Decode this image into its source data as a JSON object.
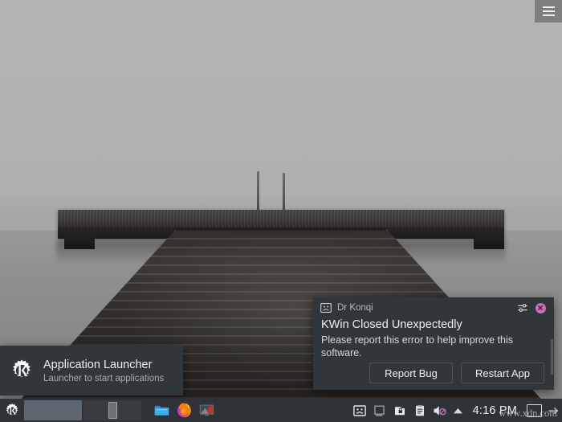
{
  "desktop": {
    "wallpaper_name": "pier-on-foggy-lake",
    "window_button": {
      "icon": "hamburger-menu-icon",
      "label": ""
    }
  },
  "tooltip": {
    "icon": "kde-k-icon",
    "title": "Application Launcher",
    "subtitle": "Launcher to start applications"
  },
  "notification": {
    "app_icon": "sad-face-icon",
    "app_name": "Dr Konqi",
    "configure_icon": "sliders-icon",
    "close_icon": "close-icon",
    "title": "KWin Closed Unexpectedly",
    "message": "Please report this error to help improve this software.",
    "actions": [
      {
        "label": "Report Bug",
        "name": "report-bug-button"
      },
      {
        "label": "Restart App",
        "name": "restart-app-button"
      }
    ],
    "colors": {
      "background": "#31363b",
      "close_button": "#c96fb4",
      "text": "#eff0f1"
    }
  },
  "panel": {
    "launcher": {
      "icon": "kde-k-icon",
      "label": "Application Launcher"
    },
    "tasks": [
      {
        "name": "task-active",
        "state": "active",
        "label": ""
      },
      {
        "name": "task-window",
        "state": "normal",
        "label": ""
      }
    ],
    "launchers": [
      {
        "name": "dolphin-file-manager",
        "icon": "folder-icon",
        "label": "Dolphin"
      },
      {
        "name": "firefox-browser",
        "icon": "firefox-icon",
        "label": "Firefox"
      },
      {
        "name": "display-settings",
        "icon": "monitor-icon",
        "label": "Display"
      }
    ],
    "tray": [
      {
        "name": "dr-konqi-tray",
        "icon": "sad-face-icon"
      },
      {
        "name": "kde-connect-tray",
        "icon": "device-disconnected-icon"
      },
      {
        "name": "clipboard-tray",
        "icon": "clipboard-lock-icon"
      },
      {
        "name": "notes-tray",
        "icon": "notes-icon"
      },
      {
        "name": "volume-tray",
        "icon": "speaker-muted-icon"
      }
    ],
    "tray_expand_icon": "chevron-up-icon",
    "clock": "4:16 PM",
    "pager": {
      "name": "desktop-pager",
      "icon": "virtual-desktop-icon"
    },
    "panel_handle_icon": "panel-handle-icon",
    "colors": {
      "background": "#2f3338",
      "active_task": "#5b6670"
    }
  },
  "watermark": {
    "text": "www.xdn.com"
  }
}
